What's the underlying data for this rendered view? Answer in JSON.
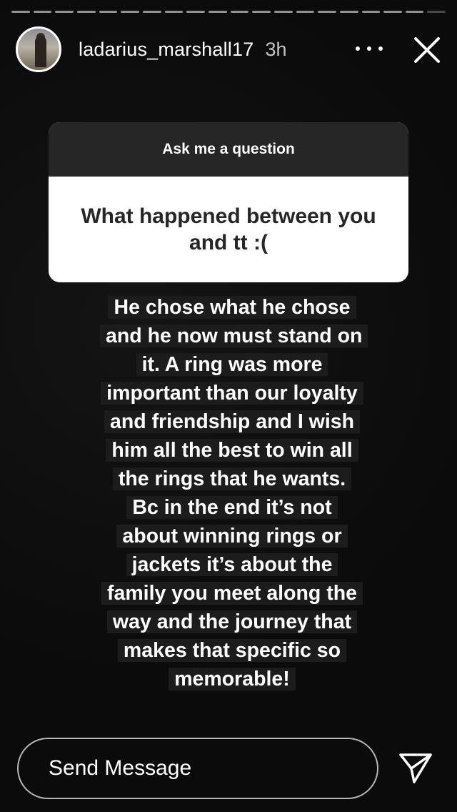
{
  "header": {
    "username": "ladarius_marshall17",
    "time": "3h"
  },
  "progress": {
    "segments": 20,
    "active": 19
  },
  "sticker": {
    "title": "Ask me a question",
    "question": "What happened between you and tt :("
  },
  "answer": {
    "text": "He chose what he chose and he now must stand on it. A ring was more important than our loyalty and friendship and I wish him all the best to win all the rings that he wants. Bc in the end it’s not about winning rings or jackets it’s about the family you meet along the way and the journey that makes that specific so memorable!"
  },
  "footer": {
    "message_placeholder": "Send Message"
  },
  "icons": {
    "more": "more-horizontal-icon",
    "close": "close-icon",
    "send": "paper-plane-icon"
  },
  "colors": {
    "background": "#0b0b0b",
    "sticker_header": "#262626",
    "sticker_body": "#ffffff",
    "text_highlight": "#1c1c1c"
  }
}
